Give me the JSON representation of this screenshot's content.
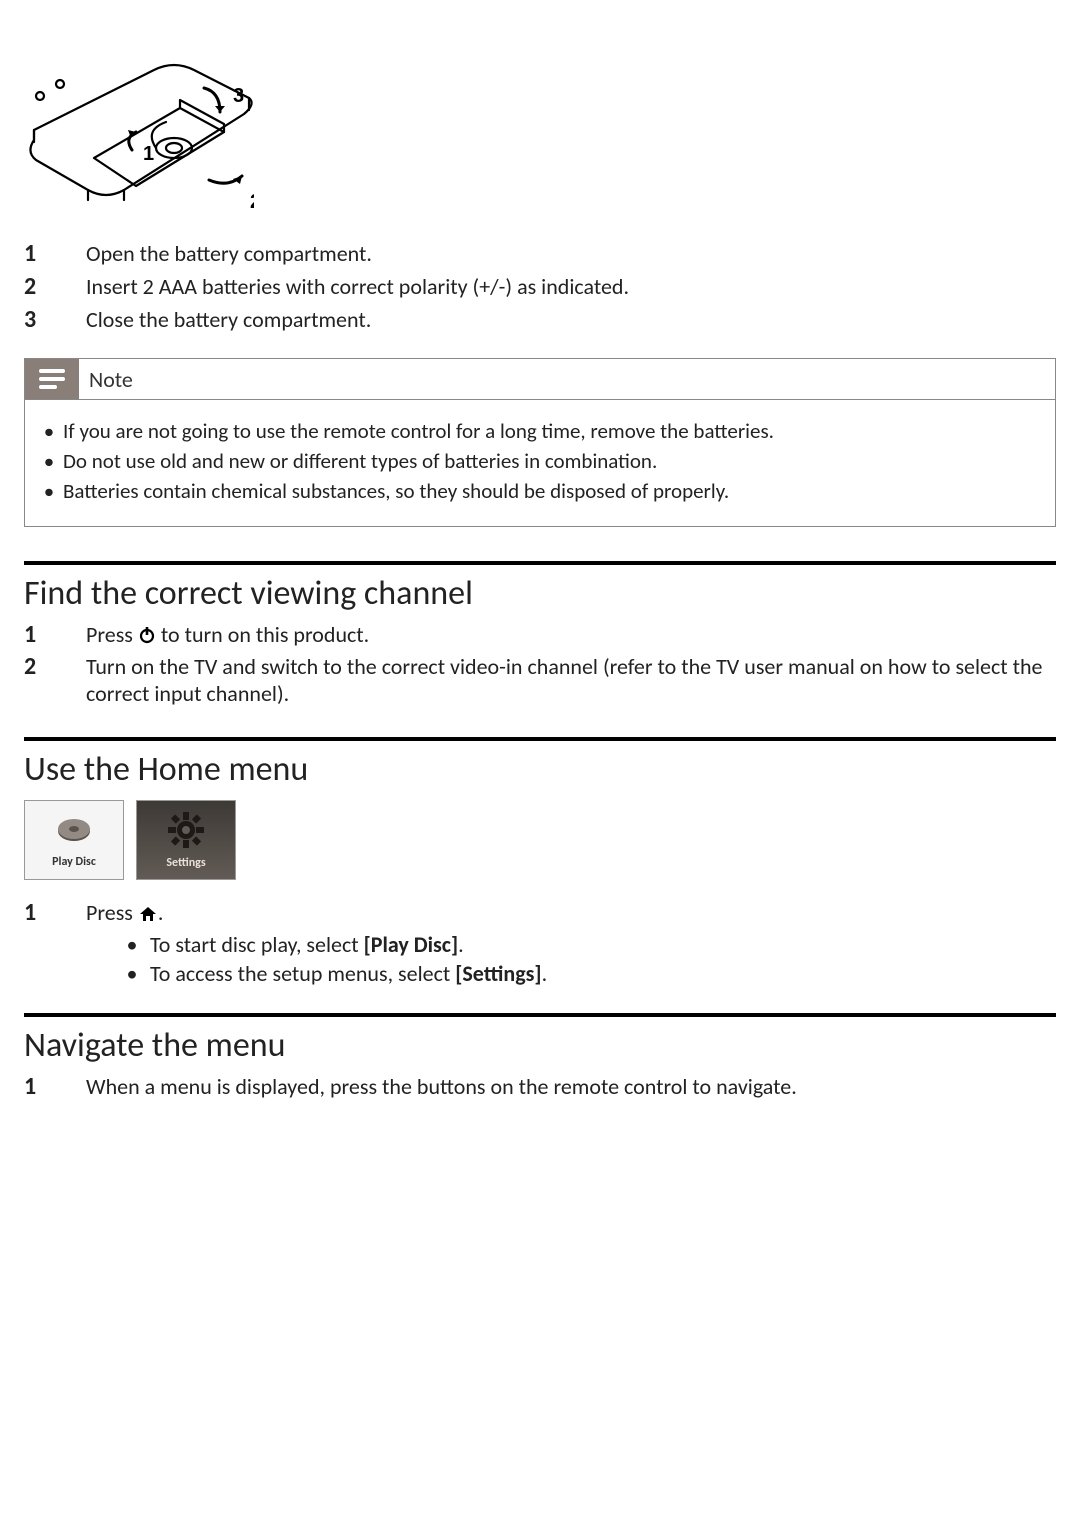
{
  "battery_steps": [
    "Open the battery compartment.",
    "Insert 2 AAA batteries with correct polarity (+/-) as indicated.",
    "Close the battery compartment."
  ],
  "note": {
    "title": "Note",
    "items": [
      "If you are not going to use the remote control for a long time, remove the batteries.",
      "Do not use old and new or different types of batteries in combination.",
      "Batteries contain chemical substances, so they should be disposed of properly."
    ]
  },
  "section_viewing": {
    "title": "Find the correct viewing channel",
    "step1_prefix": "Press ",
    "step1_suffix": " to turn on this product.",
    "step2": "Turn on the TV and switch to the correct video-in channel (refer to the TV user manual on how to select the correct input channel)."
  },
  "section_home": {
    "title": "Use the Home menu",
    "tiles": {
      "play": "Play Disc",
      "settings": "Settings"
    },
    "step1_prefix": "Press ",
    "step1_suffix": ".",
    "bullets": {
      "b1_prefix": "To start disc play, select ",
      "b1_bold": "[Play Disc]",
      "b1_suffix": ".",
      "b2_prefix": "To access the setup menus, select ",
      "b2_bold": "[Settings]",
      "b2_suffix": "."
    }
  },
  "section_navigate": {
    "title": "Navigate the menu",
    "step1": "When a menu is displayed, press the buttons on the remote control to navigate."
  }
}
